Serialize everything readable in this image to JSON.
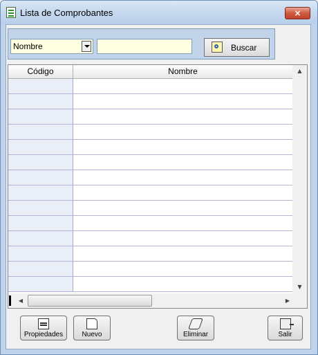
{
  "window": {
    "title": "Lista de Comprobantes",
    "close_label": "×"
  },
  "search": {
    "field_selected": "Nombre",
    "query_value": "",
    "search_label": "Buscar"
  },
  "table": {
    "columns": [
      "Código",
      "Nombre"
    ],
    "rows": [
      [
        "",
        ""
      ],
      [
        "",
        ""
      ],
      [
        "",
        ""
      ],
      [
        "",
        ""
      ],
      [
        "",
        ""
      ],
      [
        "",
        ""
      ],
      [
        "",
        ""
      ],
      [
        "",
        ""
      ],
      [
        "",
        ""
      ],
      [
        "",
        ""
      ],
      [
        "",
        ""
      ],
      [
        "",
        ""
      ],
      [
        "",
        ""
      ],
      [
        "",
        ""
      ]
    ]
  },
  "toolbar": {
    "propiedades_label": "Propiedades",
    "nuevo_label": "Nuevo",
    "eliminar_label": "Eliminar",
    "salir_label": "Salir"
  },
  "icons": [
    "document-icon",
    "close-icon",
    "chevron-down-icon",
    "search-icon",
    "properties-icon",
    "new-document-icon",
    "eraser-icon",
    "exit-icon"
  ]
}
